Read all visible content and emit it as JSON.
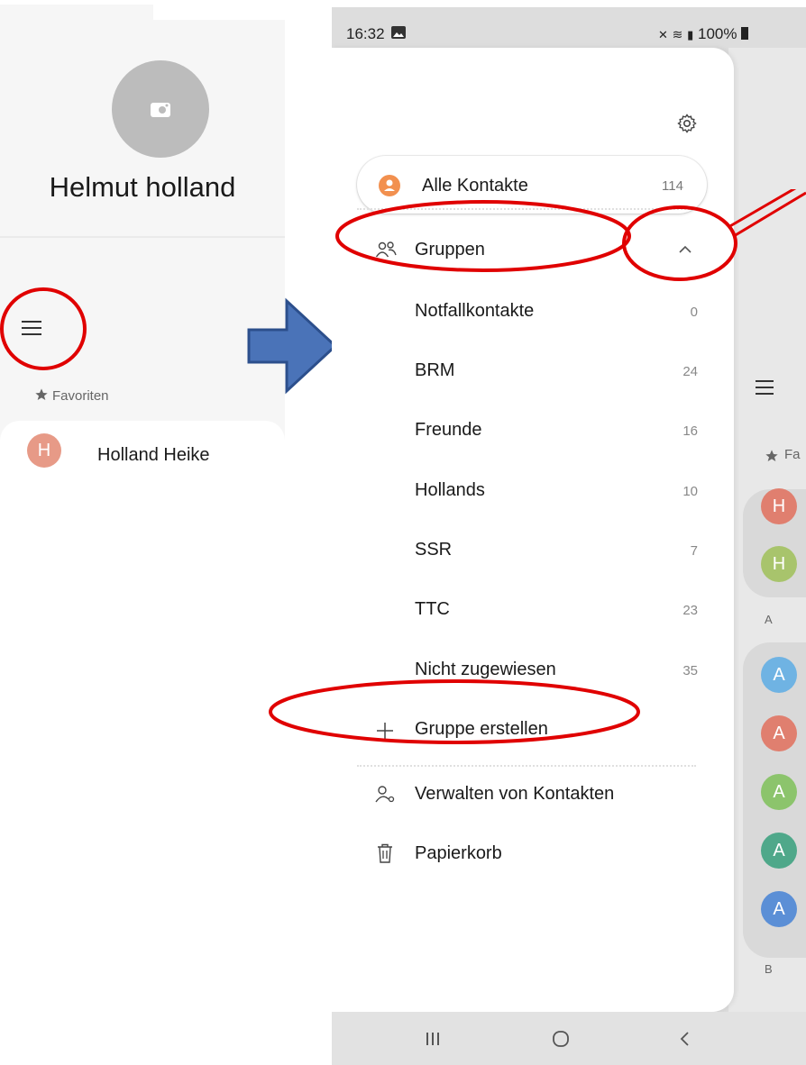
{
  "profile": {
    "name": "Helmut holland",
    "favorites_label": "Favoriten",
    "favorite_contact": {
      "initial": "H",
      "name": "Holland Heike",
      "color": "#e79a87"
    }
  },
  "status_bar": {
    "time": "16:32",
    "right": "100%"
  },
  "drawer": {
    "all_contacts": {
      "label": "Alle Kontakte",
      "count": "114"
    },
    "groups_label": "Gruppen",
    "groups": [
      {
        "name": "Notfallkontakte",
        "count": "0"
      },
      {
        "name": "BRM",
        "count": "24"
      },
      {
        "name": "Freunde",
        "count": "16"
      },
      {
        "name": "Hollands",
        "count": "10"
      },
      {
        "name": "SSR",
        "count": "7"
      },
      {
        "name": "TTC",
        "count": "23"
      },
      {
        "name": "Nicht zugewiesen",
        "count": "35"
      }
    ],
    "create_group": "Gruppe erstellen",
    "manage_contacts": "Verwalten von Kontakten",
    "trash": "Papierkorb"
  },
  "background_list": {
    "favorites_short": "Fa",
    "section_a": "A",
    "section_b": "B",
    "favorites": [
      {
        "initial": "H",
        "color": "#e07f6f"
      },
      {
        "initial": "H",
        "color": "#a8c46c"
      }
    ],
    "a_contacts": [
      {
        "initial": "A",
        "color": "#6fb3e3"
      },
      {
        "initial": "A",
        "color": "#e07f6f"
      },
      {
        "initial": "A",
        "color": "#8cc46c"
      },
      {
        "initial": "A",
        "color": "#4fa88a"
      },
      {
        "initial": "A",
        "color": "#5b8fd6"
      }
    ]
  },
  "colors": {
    "annotation": "#e00000",
    "arrow": "#4a73b8",
    "accent": "#f2904f"
  }
}
